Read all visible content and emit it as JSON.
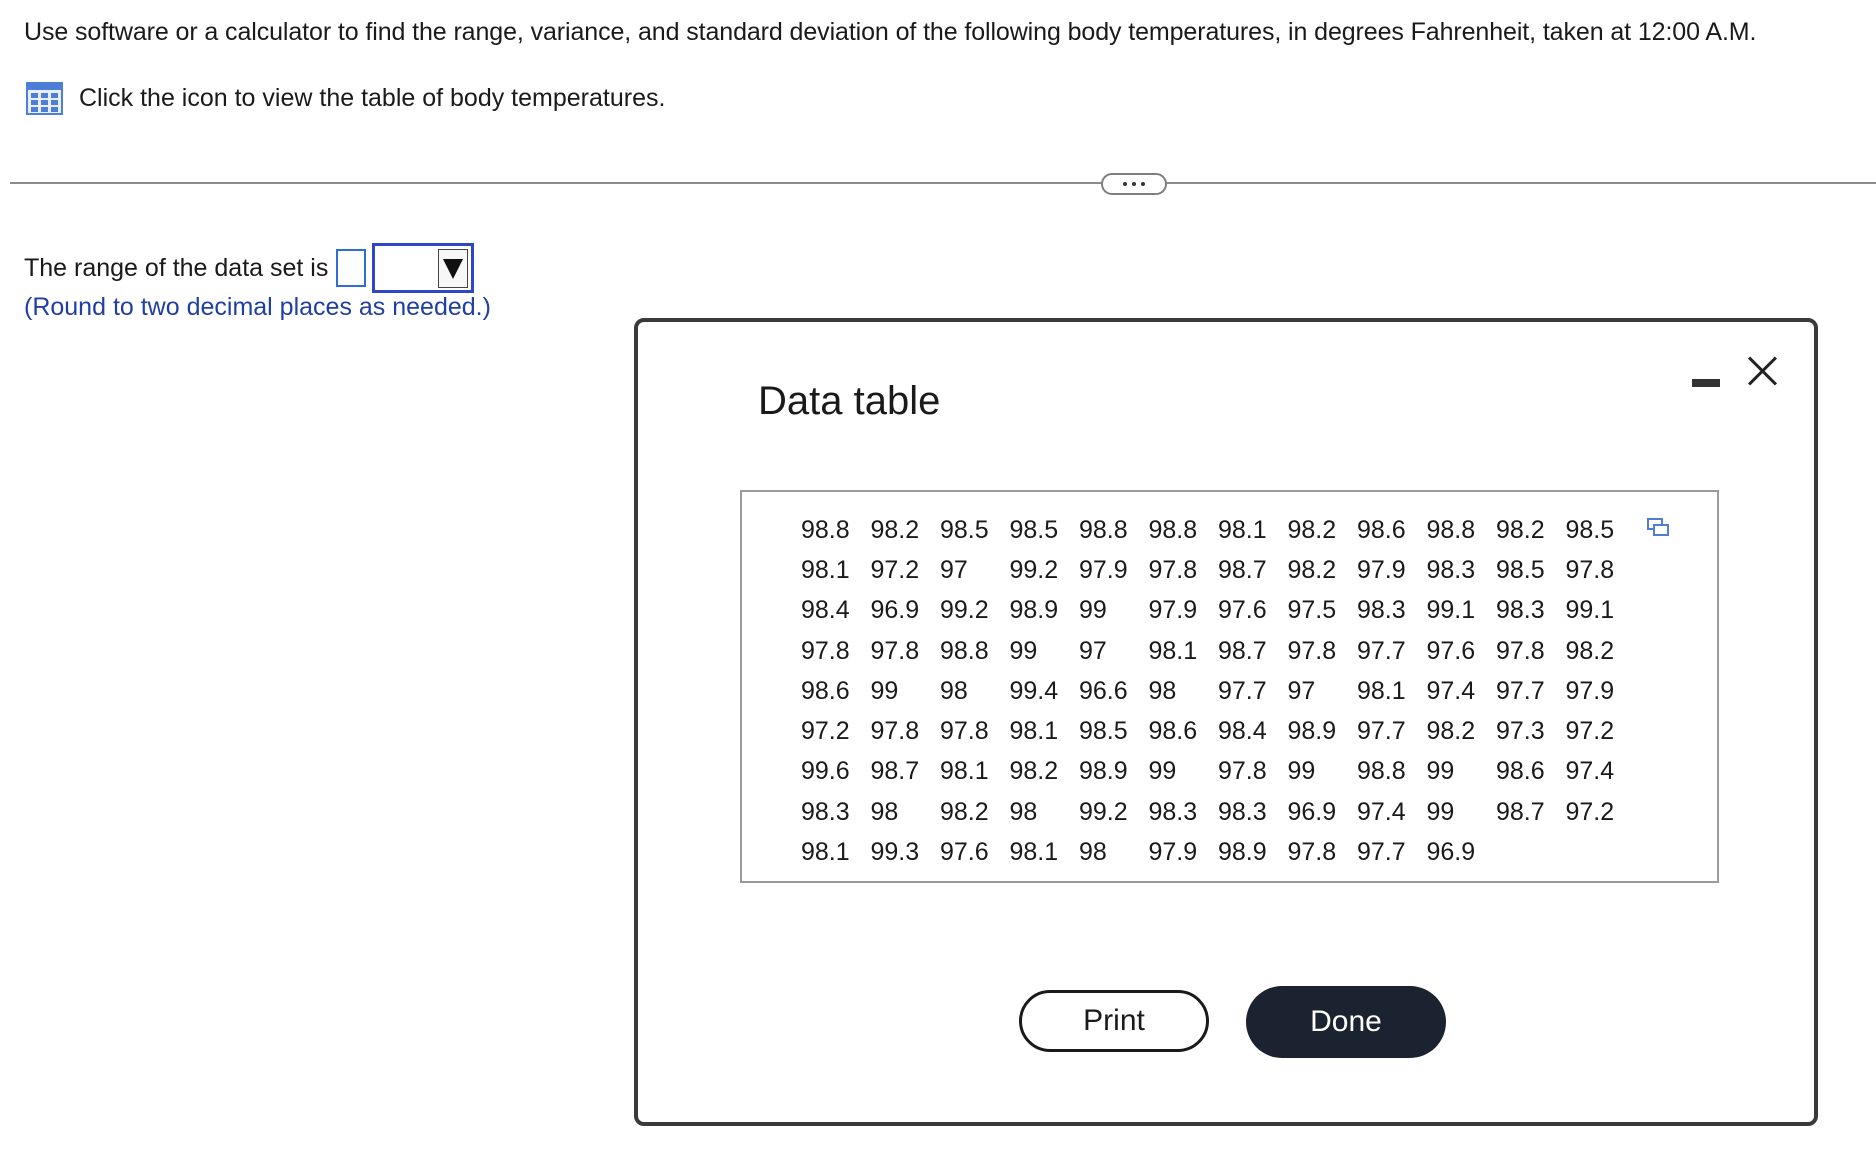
{
  "question": {
    "text": "Use software or a calculator to find the range, variance, and standard deviation of the following body temperatures, in degrees Fahrenheit, taken at 12:00 A.M.",
    "table_link_text": "Click the icon to view the table of body temperatures."
  },
  "answer": {
    "range_label": "The range of the data set is",
    "input_value": "",
    "unit_selected": "",
    "round_note": "(Round to two decimal places as needed.)"
  },
  "modal": {
    "title": "Data table",
    "print_label": "Print",
    "done_label": "Done",
    "rows": [
      [
        "98.8",
        "98.2",
        "98.5",
        "98.5",
        "98.8",
        "98.8",
        "98.1",
        "98.2",
        "98.6",
        "98.8",
        "98.2",
        "98.5"
      ],
      [
        "98.1",
        "97.2",
        "97",
        "99.2",
        "97.9",
        "97.8",
        "98.7",
        "98.2",
        "97.9",
        "98.3",
        "98.5",
        "97.8"
      ],
      [
        "98.4",
        "96.9",
        "99.2",
        "98.9",
        "99",
        "97.9",
        "97.6",
        "97.5",
        "98.3",
        "99.1",
        "98.3",
        "99.1"
      ],
      [
        "97.8",
        "97.8",
        "98.8",
        "99",
        "97",
        "98.1",
        "98.7",
        "97.8",
        "97.7",
        "97.6",
        "97.8",
        "98.2"
      ],
      [
        "98.6",
        "99",
        "98",
        "99.4",
        "96.6",
        "98",
        "97.7",
        "97",
        "98.1",
        "97.4",
        "97.7",
        "97.9"
      ],
      [
        "97.2",
        "97.8",
        "97.8",
        "98.1",
        "98.5",
        "98.6",
        "98.4",
        "98.9",
        "97.7",
        "98.2",
        "97.3",
        "97.2"
      ],
      [
        "99.6",
        "98.7",
        "98.1",
        "98.2",
        "98.9",
        "99",
        "97.8",
        "99",
        "98.8",
        "99",
        "98.6",
        "97.4"
      ],
      [
        "98.3",
        "98",
        "98.2",
        "98",
        "99.2",
        "98.3",
        "98.3",
        "96.9",
        "97.4",
        "99",
        "98.7",
        "97.2"
      ],
      [
        "98.1",
        "99.3",
        "97.6",
        "98.1",
        "98",
        "97.9",
        "98.9",
        "97.8",
        "97.7",
        "96.9"
      ]
    ]
  },
  "icons": {
    "table_icon": "grid-table-icon",
    "expand": "ellipsis-icon",
    "minimize": "minimize-icon",
    "close": "close-icon",
    "copy": "copy-icon",
    "dropdown": "triangle-down-icon"
  },
  "colors": {
    "accent_blue": "#2f47c7",
    "note_blue": "#1f3fa3",
    "done_bg": "#1b2230",
    "icon_blue": "#4d7fd6"
  }
}
